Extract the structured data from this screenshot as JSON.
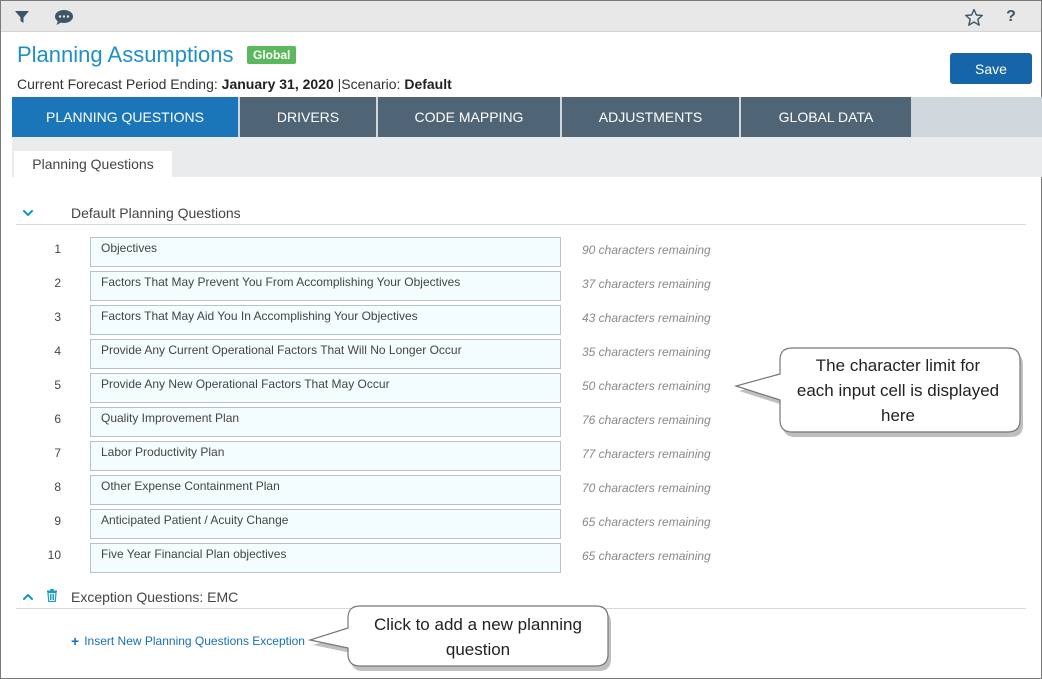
{
  "toolbar": {
    "filter_icon": "filter-icon",
    "comment_icon": "comment-icon",
    "star_icon": "star-icon",
    "help_label": "?"
  },
  "header": {
    "title": "Planning Assumptions",
    "badge": "Global",
    "period_label": "Current Forecast Period Ending:",
    "period_value": "January 31, 2020",
    "separator": "|",
    "scenario_label": "Scenario:",
    "scenario_value": "Default",
    "save_label": "Save"
  },
  "tabs": [
    {
      "label": "PLANNING QUESTIONS",
      "active": true
    },
    {
      "label": "DRIVERS",
      "active": false
    },
    {
      "label": "CODE MAPPING",
      "active": false
    },
    {
      "label": "ADJUSTMENTS",
      "active": false
    },
    {
      "label": "GLOBAL DATA",
      "active": false
    }
  ],
  "subtab": {
    "label": "Planning Questions"
  },
  "default_section": {
    "label": "Default Planning Questions",
    "expanded": true,
    "rows": [
      {
        "num": "1",
        "value": "Objectives",
        "remaining": "90 characters remaining"
      },
      {
        "num": "2",
        "value": "Factors That May Prevent You From Accomplishing Your Objectives",
        "remaining": "37 characters remaining"
      },
      {
        "num": "3",
        "value": "Factors That May Aid You In Accomplishing Your Objectives",
        "remaining": "43 characters remaining"
      },
      {
        "num": "4",
        "value": "Provide Any Current Operational Factors That Will No Longer Occur",
        "remaining": "35 characters remaining"
      },
      {
        "num": "5",
        "value": "Provide Any New Operational Factors That May Occur",
        "remaining": "50 characters remaining"
      },
      {
        "num": "6",
        "value": "Quality Improvement Plan",
        "remaining": "76 characters remaining"
      },
      {
        "num": "7",
        "value": "Labor Productivity Plan",
        "remaining": "77 characters remaining"
      },
      {
        "num": "8",
        "value": "Other Expense Containment Plan",
        "remaining": "70 characters remaining"
      },
      {
        "num": "9",
        "value": "Anticipated Patient / Acuity Change",
        "remaining": "65 characters remaining"
      },
      {
        "num": "10",
        "value": "Five Year Financial Plan objectives",
        "remaining": "65 characters remaining"
      }
    ]
  },
  "exception_section": {
    "label": "Exception Questions: EMC",
    "insert_link": "Insert New Planning Questions Exception",
    "insert_prefix": "+"
  },
  "callouts": {
    "limit": [
      "The character limit for",
      "each input cell is displayed",
      "here"
    ],
    "insert": [
      "Click to add a new planning",
      "question"
    ]
  },
  "colors": {
    "accent": "#1a76b8",
    "tab_inactive": "#4f6576",
    "badge": "#5cb85c",
    "save": "#1565a8"
  }
}
